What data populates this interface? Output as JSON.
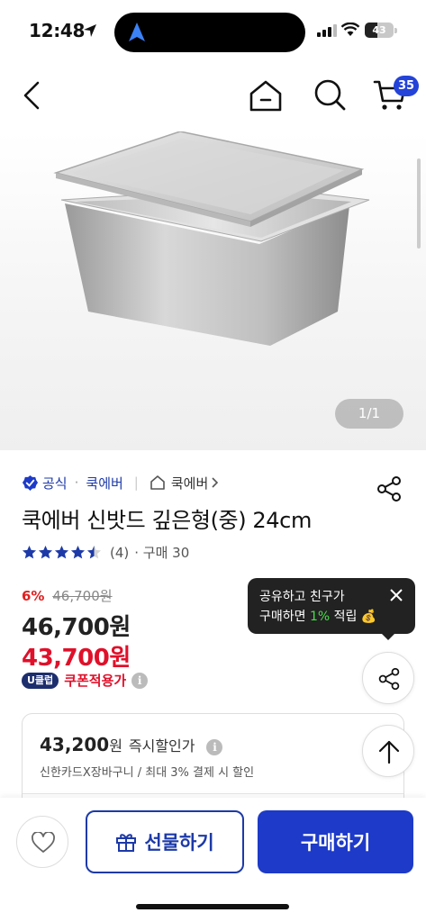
{
  "status_bar": {
    "time": "12:48",
    "battery": "43",
    "battery_level": 0.43
  },
  "nav": {
    "cart_count": "35"
  },
  "gallery": {
    "pager": "1/1"
  },
  "product": {
    "official_label": "공식",
    "brand": "쿡에버",
    "category": "쿡에버",
    "title": "쿡에버 신밧드 깊은형(중) 24cm",
    "rating": 4.5,
    "review_count": "(4)",
    "purchase_count": "· 구매 30",
    "discount_pct": "6%",
    "original_price": "46,700원",
    "price": "46,700원",
    "sale_price": "43,700원",
    "uclub_badge": "U클럽",
    "coupon_label": "쿠폰적용가"
  },
  "tooltip": {
    "line1": "공유하고 친구가",
    "line2_pre": "구매하면",
    "line2_pct": "1%",
    "line2_post": "적립 💰"
  },
  "instant_discount": {
    "price": "43,200",
    "unit": "원",
    "label": "즉시할인가",
    "sub": "신한카드X장바구니 / 최대 3% 결제 시 할인"
  },
  "bottom_bar": {
    "gift_label": "선물하기",
    "buy_label": "구매하기"
  },
  "colors": {
    "brand_blue": "#1d3ac8",
    "sale_red": "#e0102a",
    "star": "#1d3aa8"
  }
}
